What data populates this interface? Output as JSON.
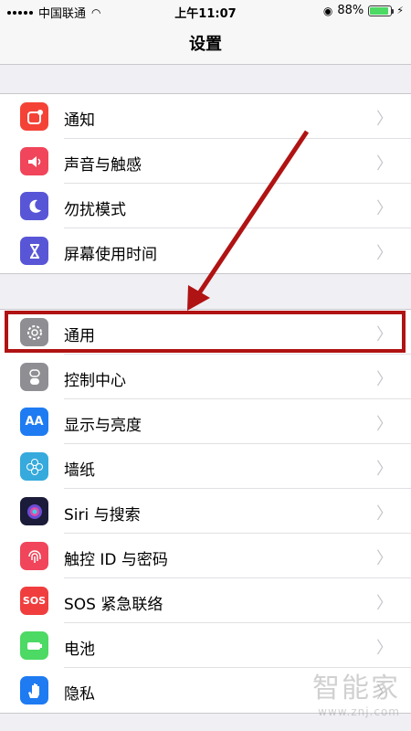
{
  "status_bar": {
    "carrier": "中国联通",
    "time": "上午11:07",
    "battery_percent": "88%"
  },
  "nav": {
    "title": "设置"
  },
  "groups": [
    {
      "items": [
        {
          "label": "通知",
          "icon": "notifications-icon",
          "color": "#f44336"
        },
        {
          "label": "声音与触感",
          "icon": "sound-icon",
          "color": "#f0455a"
        },
        {
          "label": "勿扰模式",
          "icon": "moon-icon",
          "color": "#5856d6"
        },
        {
          "label": "屏幕使用时间",
          "icon": "hourglass-icon",
          "color": "#5856d6"
        }
      ]
    },
    {
      "items": [
        {
          "label": "通用",
          "icon": "gear-icon",
          "color": "#8e8e93"
        },
        {
          "label": "控制中心",
          "icon": "toggle-icon",
          "color": "#8e8e93"
        },
        {
          "label": "显示与亮度",
          "icon": "text-size-icon",
          "color": "#1e7bf1"
        },
        {
          "label": "墙纸",
          "icon": "flower-icon",
          "color": "#36aadc"
        },
        {
          "label": "Siri 与搜索",
          "icon": "siri-icon",
          "color": "#1b1b3a"
        },
        {
          "label": "触控 ID 与密码",
          "icon": "fingerprint-icon",
          "color": "#f0455a"
        },
        {
          "label": "SOS 紧急联络",
          "icon": "sos-icon",
          "color": "#f03e3e",
          "icon_text": "SOS"
        },
        {
          "label": "电池",
          "icon": "battery-icon",
          "color": "#4cd964"
        },
        {
          "label": "隐私",
          "icon": "hand-icon",
          "color": "#1e7bf1"
        }
      ]
    }
  ],
  "watermark": {
    "line1": "智能家",
    "line2": "www.znj.com"
  }
}
